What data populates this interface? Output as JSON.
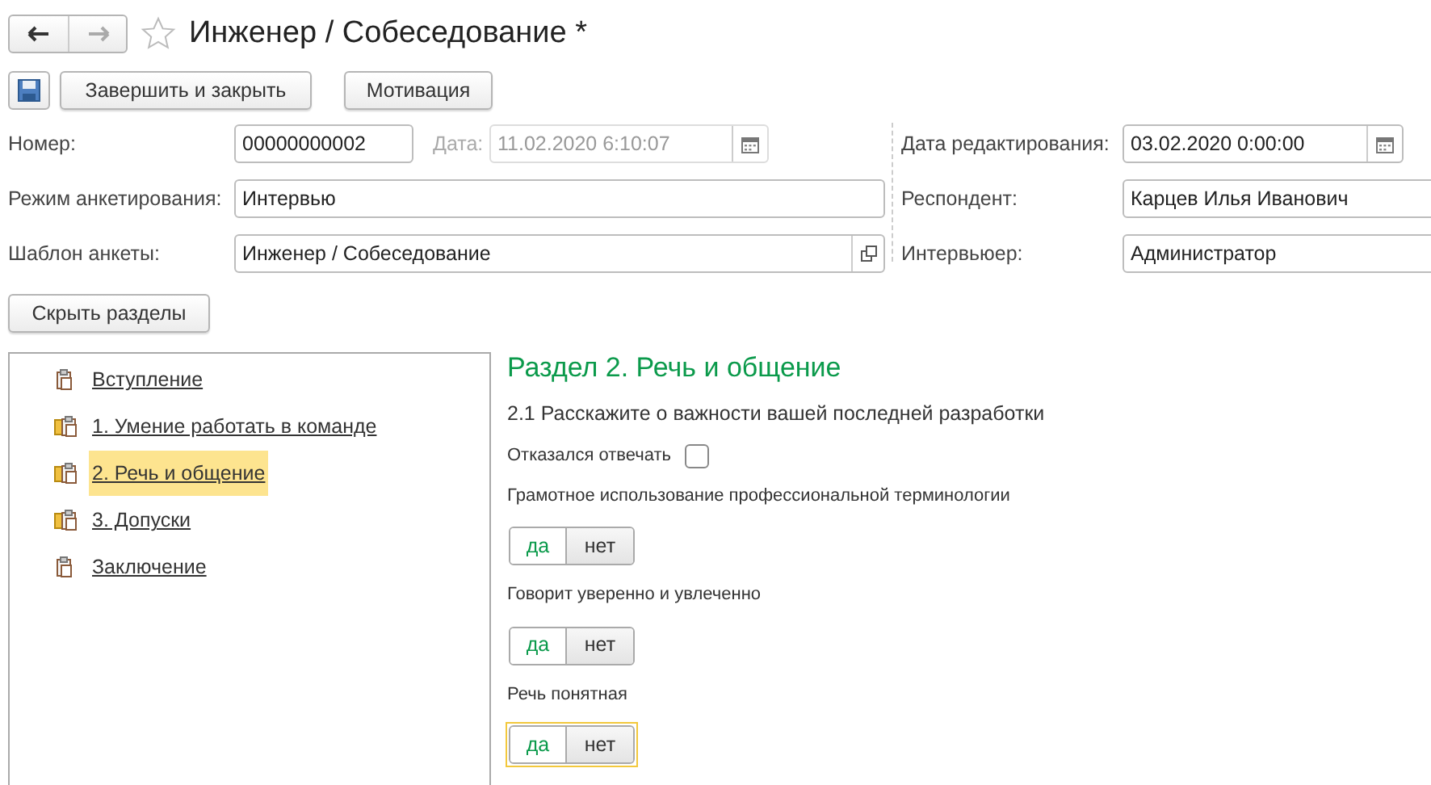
{
  "window": {
    "title": "Инженер / Собеседование *",
    "favorite": false
  },
  "toolbar": {
    "buttons": [
      "Завершить и закрыть",
      "Мотивация"
    ]
  },
  "fields": {
    "number": {
      "label": "Номер:",
      "value": "00000000002"
    },
    "date": {
      "label": "Дата:",
      "value": "11.02.2020  6:10:07",
      "disabled": true
    },
    "mode": {
      "label": "Режим анкетирования:",
      "value": "Интервью"
    },
    "template": {
      "label": "Шаблон анкеты:",
      "value": "Инженер / Собеседование"
    },
    "edit_date": {
      "label": "Дата редактирования:",
      "value": "03.02.2020  0:00:00"
    },
    "respondent": {
      "label": "Респондент:",
      "value": "Карцев Илья Иванович"
    },
    "interviewer": {
      "label": "Интервьюер:",
      "value": "Администратор"
    }
  },
  "hide_sections_button": "Скрыть разделы",
  "sections": [
    {
      "label": "Вступление",
      "kind": "plain",
      "selected": false
    },
    {
      "label": "1. Умение работать в команде",
      "kind": "folder",
      "selected": false
    },
    {
      "label": "2. Речь и общение",
      "kind": "folder",
      "selected": true
    },
    {
      "label": "3. Допуски",
      "kind": "folder",
      "selected": false
    },
    {
      "label": "Заключение",
      "kind": "plain",
      "selected": false
    }
  ],
  "content": {
    "heading": "Раздел 2. Речь и общение",
    "question": "2.1 Расскажите о важности вашей последней разработки",
    "refused": {
      "label": "Отказался отвечать",
      "checked": false
    },
    "criteria": [
      {
        "label": "Грамотное использование профессиональной терминологии",
        "focused": false,
        "options": [
          {
            "label": "да",
            "kind": "yes"
          },
          {
            "label": "нет",
            "kind": "no"
          }
        ]
      },
      {
        "label": "Говорит уверенно и увлеченно",
        "focused": false,
        "options": [
          {
            "label": "да",
            "kind": "yes"
          },
          {
            "label": "нет",
            "kind": "no"
          }
        ]
      },
      {
        "label": "Речь понятная",
        "focused": true,
        "options": [
          {
            "label": "да",
            "kind": "yes"
          },
          {
            "label": "нет",
            "kind": "no"
          }
        ]
      }
    ]
  }
}
